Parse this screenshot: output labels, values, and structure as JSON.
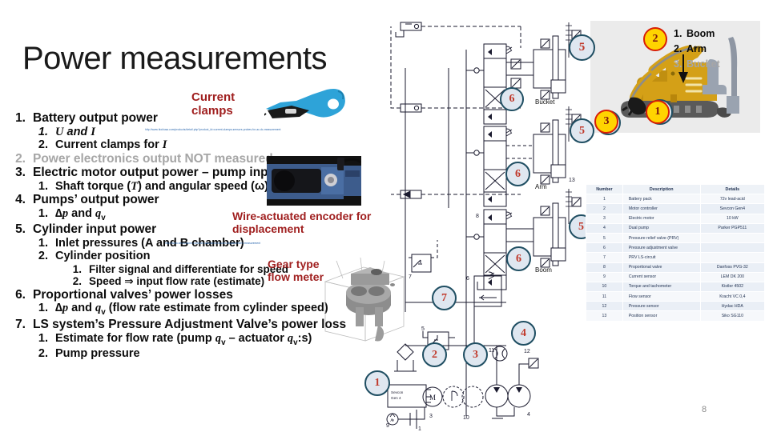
{
  "slide": {
    "title": "Power measurements",
    "page_number": "8"
  },
  "bullets": [
    {
      "level": 1,
      "num": "1.",
      "text": "Battery output power",
      "dim": false
    },
    {
      "level": 2,
      "num": "1.",
      "text": "U and I",
      "dim": false,
      "italic": true
    },
    {
      "level": 2,
      "num": "2.",
      "text": "Current clamps for I",
      "dim": false
    },
    {
      "level": 1,
      "num": "2.",
      "text": "Power electronics output NOT measured",
      "dim": true
    },
    {
      "level": 1,
      "num": "3.",
      "text": "Electric motor output power – pump input power",
      "dim": false
    },
    {
      "level": 2,
      "num": "1.",
      "text": "Shaft torque (T) and angular speed (ω)",
      "dim": false
    },
    {
      "level": 1,
      "num": "4.",
      "text": "Pumps’ output power",
      "dim": false
    },
    {
      "level": 2,
      "num": "1.",
      "text": "∆p and qv",
      "dim": false
    },
    {
      "level": 1,
      "num": "5.",
      "text": "Cylinder input power",
      "dim": false
    },
    {
      "level": 2,
      "num": "1.",
      "text": "Inlet pressures (A and B chamber)",
      "dim": false
    },
    {
      "level": 2,
      "num": "2.",
      "text": "Cylinder position",
      "dim": false
    },
    {
      "level": 3,
      "num": "1.",
      "text": "Filter signal and differentiate for speed",
      "dim": false
    },
    {
      "level": 3,
      "num": "2.",
      "text": "Speed ⇒ input flow rate (estimate)",
      "dim": false
    },
    {
      "level": 1,
      "num": "6.",
      "text": "Proportional valves’ power losses",
      "dim": false
    },
    {
      "level": 2,
      "num": "1.",
      "text": "∆p and qv (flow rate estimate from cylinder speed)",
      "dim": false
    },
    {
      "level": 1,
      "num": "7.",
      "text": "LS system’s Pressure Adjustment Valve’s power loss",
      "dim": false
    },
    {
      "level": 2,
      "num": "1.",
      "text": "Estimate for flow rate (pump qv – actuator qv:s)",
      "dim": false
    },
    {
      "level": 2,
      "num": "2.",
      "text": "Pump pressure",
      "dim": false
    }
  ],
  "annotations": {
    "current_clamps": "Current clamps",
    "current_clamps_line1": "Current",
    "current_clamps_line2": "clamps",
    "wire_encoder_line1": "Wire-actuated encoder for",
    "wire_encoder_line2": "displacement",
    "flow_meter_line1": "Gear type",
    "flow_meter_line2": "flow meter",
    "link1": "http://www.hiokiusa.com/products/detail.php?product_id=current-clamps-sensors-probes-for-ac-dc-measurement",
    "link2": "http://www.sensorsone.com/wire-actuated-encoder-displacement-measurement"
  },
  "excavator": {
    "legend": [
      {
        "num": "1.",
        "label": "Boom",
        "dim": false
      },
      {
        "num": "2.",
        "label": "Arm",
        "dim": false
      },
      {
        "num": "3.",
        "label": "Bucket",
        "dim": true
      }
    ],
    "markers": [
      {
        "num": "2",
        "style": "red"
      },
      {
        "num": "1",
        "style": "red"
      },
      {
        "num": "3",
        "style": "red"
      }
    ]
  },
  "schematic": {
    "labels": [
      "Bucket",
      "Arm",
      "Boom"
    ],
    "markers": [
      "5",
      "6",
      "5",
      "6",
      "5",
      "6",
      "7",
      "4",
      "3",
      "2",
      "1"
    ],
    "part_numbers": [
      "1",
      "2",
      "3",
      "4",
      "5",
      "6",
      "7",
      "8",
      "9",
      "10",
      "11",
      "12",
      "13"
    ]
  },
  "parts_table": {
    "headers": [
      "Number",
      "Description",
      "Details"
    ],
    "rows": [
      [
        "1",
        "Battery pack",
        "72v lead-acid"
      ],
      [
        "2",
        "Motor controller",
        "Sevcon Gen4"
      ],
      [
        "3",
        "Electric motor",
        "10 kW"
      ],
      [
        "4",
        "Dual pump",
        "Parker PGP511"
      ],
      [
        "5",
        "Pressure relief valve (PRV)",
        ""
      ],
      [
        "6",
        "Pressure adjustment valve",
        ""
      ],
      [
        "7",
        "PRV LS-circuit",
        ""
      ],
      [
        "8",
        "Proportional valve",
        "Danfoss PVG-32"
      ],
      [
        "9",
        "Current sensor",
        "LEM DK 200"
      ],
      [
        "10",
        "Torque and tachometer",
        "Kistler 4502"
      ],
      [
        "11",
        "Flow sensor",
        "Kracht VC 0,4"
      ],
      [
        "12",
        "Pressure sensor",
        "Hydac HDA"
      ],
      [
        "13",
        "Position sensor",
        "Siko SG110"
      ]
    ]
  },
  "colors": {
    "accent_red": "#a02020",
    "marker_blue_fill": "#dfe7f0",
    "marker_blue_border": "#1f4e62",
    "marker_number": "#c0392b",
    "dim_text": "#a6a6a6",
    "link": "#1f5fa9",
    "table_header_bg": "#eef2f7"
  }
}
